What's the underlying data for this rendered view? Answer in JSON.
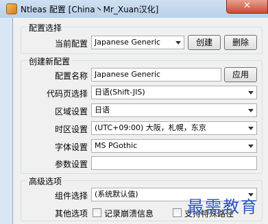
{
  "window": {
    "title": "Ntleas 配置 [China丶Mr_Xuan汉化]",
    "close_label": "✕"
  },
  "config_select": {
    "group_label": "配置选择",
    "current_label": "当前配置",
    "current_value": "Japanese Generic",
    "create_button": "创建",
    "delete_button": "删除"
  },
  "create_config": {
    "group_label": "创建新配置",
    "name_label": "配置名称",
    "name_value": "Japanese Generic",
    "apply_button": "应用",
    "codepage_label": "代码页选择",
    "codepage_value": "日语(Shift-JIS)",
    "locale_label": "区域设置",
    "locale_value": "日语",
    "timezone_label": "时区设置",
    "timezone_value": "(UTC+09:00) 大阪，札幌，东京",
    "font_label": "字体设置",
    "font_value": "MS PGothic",
    "params_label": "参数设置",
    "params_value": ""
  },
  "advanced": {
    "group_label": "高级选项",
    "component_label": "组件选择",
    "component_value": "(系统默认值)",
    "other_label": "其他选项",
    "log_crash_label": "记录崩溃信息",
    "keep_path_label": "支持特殊路径"
  },
  "watermark": "最需教育"
}
